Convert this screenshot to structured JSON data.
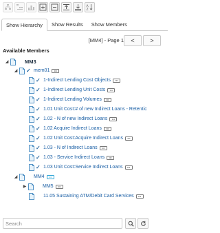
{
  "tabs": [
    {
      "label": "Show Hierarchy",
      "active": true
    },
    {
      "label": "Show Results",
      "active": false
    },
    {
      "label": "Show Members",
      "active": false
    }
  ],
  "pager": {
    "label": "[MM4] - Page 1",
    "prev": "<",
    "next": ">"
  },
  "members_title": "Available Members",
  "tree": {
    "root": "MM3",
    "group": "mem01",
    "items": [
      "1-Indirect Lending Cost Objects",
      "1-Indirect Lending Unit Costs",
      "1-Indirect Lending Volumes",
      "1.01 Unit Cost:# of new Indirect Loans - Retentic",
      "1.02 - N of new Indirect Loans",
      "1.02 Acquire Indirect Loans",
      "1.02 Unit Cost:Acquire Indirect Loans",
      "1.03 - N of Indirect Loans",
      "1.03 - Service Indirect Loans",
      "1.03 Unit Cost:Service Indirect Loans"
    ],
    "root2": "MM4",
    "sub": "MM5",
    "last": "11.05 Sustaining ATM/Debit Card Services"
  },
  "more_glyph": "•••",
  "search": {
    "placeholder": "Search",
    "value": ""
  },
  "colors": {
    "accent": "#1a5fa5",
    "highlight": "#35a8d8",
    "border": "#c8c8c8"
  }
}
